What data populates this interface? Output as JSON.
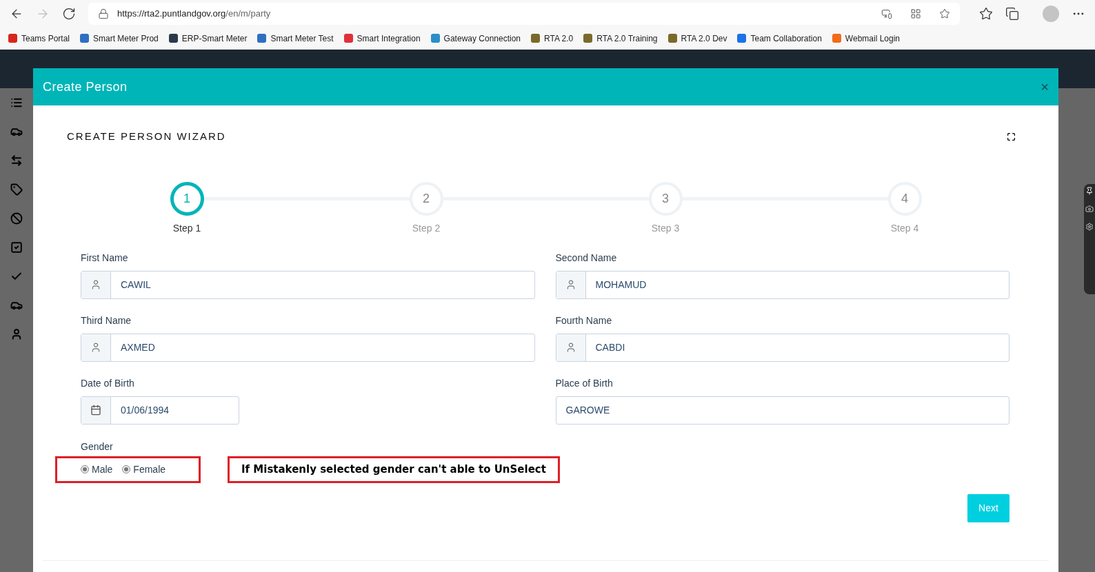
{
  "browser": {
    "url_host": "https://rta2.puntlandgov.org",
    "url_path": "/en/m/party"
  },
  "bookmarks": [
    {
      "label": "Teams Portal",
      "color": "#d9261c"
    },
    {
      "label": "Smart Meter Prod",
      "color": "#2f6fc1"
    },
    {
      "label": "ERP-Smart Meter",
      "color": "#2b3a4a"
    },
    {
      "label": "Smart Meter Test",
      "color": "#2f6fc1"
    },
    {
      "label": "Smart Integration",
      "color": "#e0303a"
    },
    {
      "label": "Gateway Connection",
      "color": "#2a8fc9"
    },
    {
      "label": "RTA 2.0",
      "color": "#7a6a2a"
    },
    {
      "label": "RTA 2.0 Training",
      "color": "#7a6a2a"
    },
    {
      "label": "RTA 2.0 Dev",
      "color": "#7a6a2a"
    },
    {
      "label": "Team Collaboration",
      "color": "#1a73e8"
    },
    {
      "label": "Webmail Login",
      "color": "#f26a1b"
    }
  ],
  "modal": {
    "title": "Create Person",
    "close": "×",
    "wizard_title": "CREATE PERSON WIZARD",
    "steps": [
      {
        "number": "1",
        "label": "Step 1",
        "selected": true
      },
      {
        "number": "2",
        "label": "Step 2",
        "selected": false
      },
      {
        "number": "3",
        "label": "Step 3",
        "selected": false
      },
      {
        "number": "4",
        "label": "Step 4",
        "selected": false
      }
    ],
    "fields": [
      {
        "label": "First Name",
        "value": "CAWIL",
        "kind": "person"
      },
      {
        "label": "Second Name",
        "value": "MOHAMUD",
        "kind": "person"
      },
      {
        "label": "Third Name",
        "value": "AXMED",
        "kind": "person"
      },
      {
        "label": "Fourth Name",
        "value": "CABDI",
        "kind": "person"
      },
      {
        "label": "Date of Birth",
        "value": "01/06/1994",
        "kind": "date"
      },
      {
        "label": "Place of Birth",
        "value": "GAROWE",
        "kind": "plain"
      }
    ],
    "gender": {
      "label": "Gender",
      "options": [
        {
          "label": "Male",
          "selected": true
        },
        {
          "label": "Female",
          "selected": true
        }
      ]
    },
    "annotation": "If Mistakenly selected gender can't able to UnSelect",
    "next_button": "Next"
  }
}
